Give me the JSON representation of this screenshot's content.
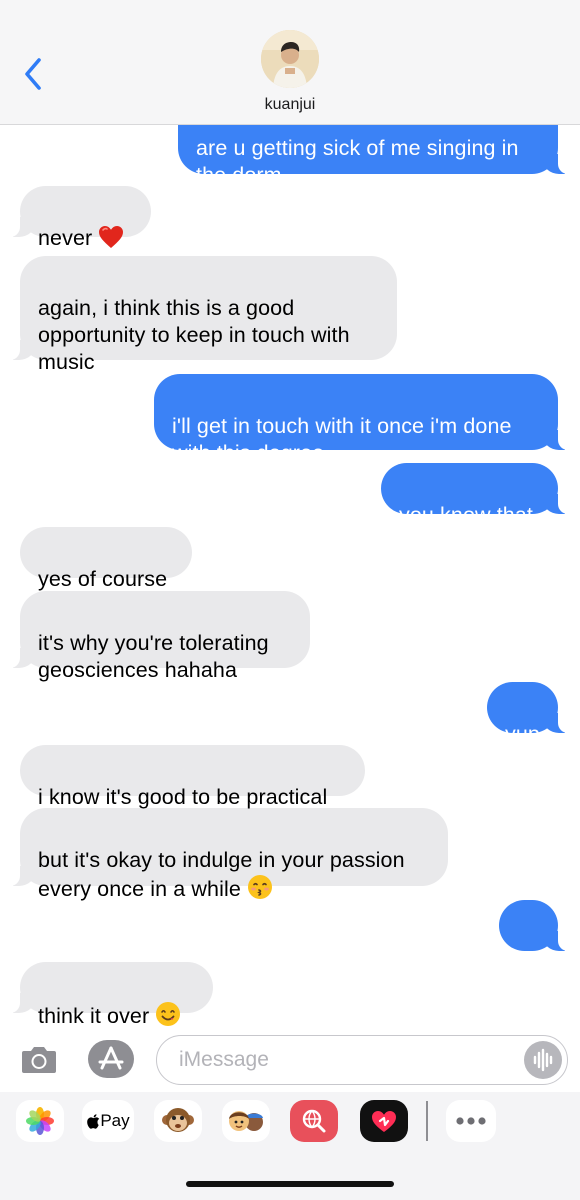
{
  "header": {
    "contact_name": "kuanjui"
  },
  "messages": [
    {
      "direction": "out",
      "text": "are u getting sick of me singing in\nthe dorm",
      "emoji": null
    },
    {
      "direction": "in",
      "text": "never",
      "emoji": "red-heart"
    },
    {
      "direction": "in",
      "text": "again, i think this is a good\nopportunity to keep in touch with\nmusic",
      "emoji": null
    },
    {
      "direction": "out",
      "text": "i'll get in touch with it once i'm done\nwith this degree",
      "emoji": null
    },
    {
      "direction": "out",
      "text": "you know that",
      "emoji": null
    },
    {
      "direction": "in",
      "text": "yes of course",
      "emoji": null
    },
    {
      "direction": "in",
      "text": "it's why you're tolerating\ngeosciences hahaha",
      "emoji": null
    },
    {
      "direction": "out",
      "text": "yup",
      "emoji": null
    },
    {
      "direction": "in",
      "text": "i know it's good to be practical",
      "emoji": null
    },
    {
      "direction": "in",
      "text": "but it's okay to indulge in your passion\nevery once in a while",
      "emoji": "kissing-face"
    },
    {
      "direction": "out",
      "text": "....",
      "emoji": null
    },
    {
      "direction": "in",
      "text": "think it over",
      "emoji": "smiling-face"
    }
  ],
  "input": {
    "placeholder": "iMessage",
    "value": ""
  },
  "app_drawer": {
    "items": [
      {
        "name": "photos-app",
        "icon": "photos-icon"
      },
      {
        "name": "apple-pay-app",
        "icon": "apple-logo-icon",
        "label": "Pay"
      },
      {
        "name": "animoji-app",
        "icon": "monkey-icon"
      },
      {
        "name": "memoji-app",
        "icon": "memoji-stickers-icon"
      },
      {
        "name": "image-search-app",
        "icon": "globe-search-icon"
      },
      {
        "name": "digital-touch-app",
        "icon": "heart-touch-icon"
      },
      {
        "name": "more-apps",
        "icon": "ellipsis-icon"
      }
    ]
  },
  "colors": {
    "outgoing_bubble": "#3b82f6",
    "incoming_bubble": "#e9e9eb",
    "accent": "#2f7cf6"
  }
}
